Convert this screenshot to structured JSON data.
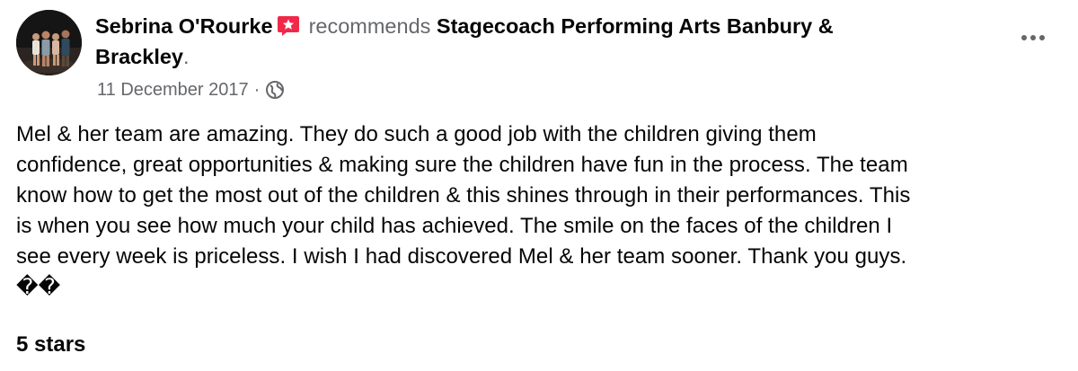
{
  "post": {
    "author": "Sebrina O'Rourke",
    "action": "recommends",
    "page": "Stagecoach Performing Arts Banbury &",
    "page_line2": "Brackley",
    "page_suffix": ".",
    "date": "11 December 2017",
    "separator": "·",
    "audience_icon": "globe-icon",
    "more_icon": "more-options-icon",
    "badge_icon": "recommendation-star-icon",
    "body_lines": [
      "Mel & her team are amazing. They do such a good job with the children giving them",
      "confidence, great opportunities & making sure the children have fun in the process. The team",
      "know how to get the most out of the children & this shines through in their performances. This",
      "is when you see how much your child has achieved. The smile on the faces of the children I",
      "see every week is priceless. I wish I had discovered Mel & her team sooner. Thank you guys.",
      "��"
    ],
    "rating": "5 stars"
  },
  "colors": {
    "text": "#050505",
    "secondary": "#65676b",
    "badge": "#f02849"
  }
}
